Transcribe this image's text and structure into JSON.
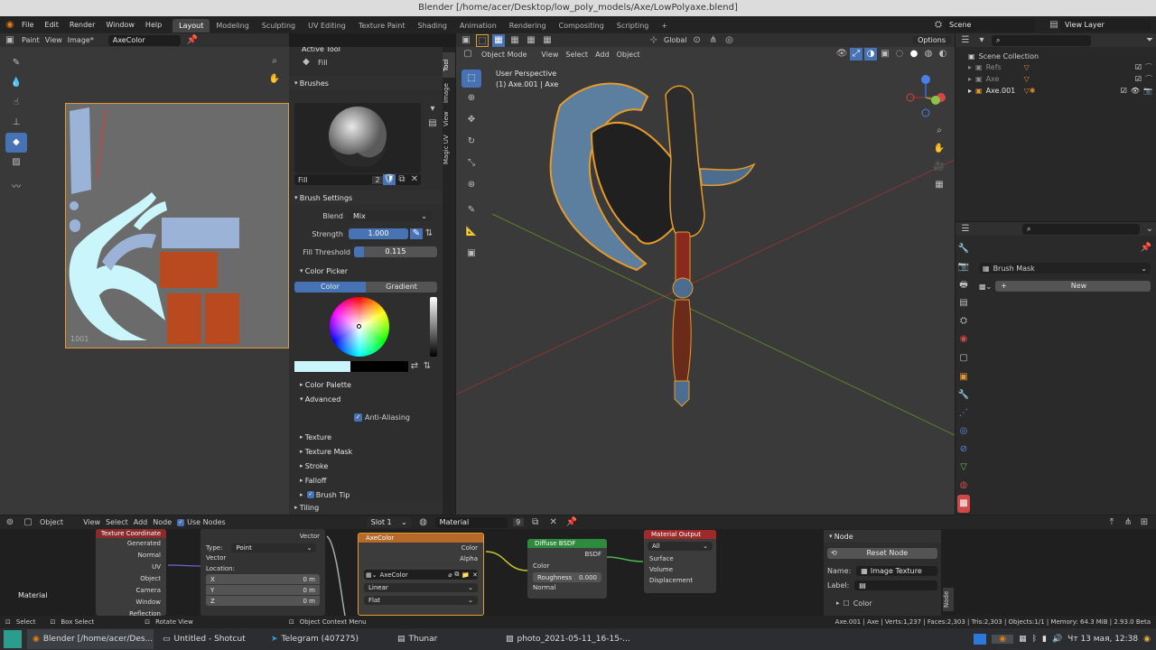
{
  "window_title": "Blender [/home/acer/Desktop/low_poly_models/Axe/LowPolyaxe.blend]",
  "menu": {
    "file": "File",
    "edit": "Edit",
    "render": "Render",
    "window": "Window",
    "help": "Help"
  },
  "workspaces": [
    "Layout",
    "Modeling",
    "Sculpting",
    "UV Editing",
    "Texture Paint",
    "Shading",
    "Animation",
    "Rendering",
    "Compositing",
    "Scripting"
  ],
  "scene": "Scene",
  "view_layer": "View Layer",
  "image_editor": {
    "mode": "Paint",
    "view": "View",
    "image_menu": "Image*",
    "image_name": "AxeColor",
    "tile_label": "1001"
  },
  "tool_panel": {
    "active_tool_header": "Active Tool",
    "active_tool": "Fill",
    "brushes_header": "Brushes",
    "brush_name": "Fill",
    "brush_users": "2",
    "brush_settings_header": "Brush Settings",
    "blend_label": "Blend",
    "blend_value": "Mix",
    "strength_label": "Strength",
    "strength_value": "1.000",
    "strength_fraction": 1.0,
    "fill_threshold_label": "Fill Threshold",
    "fill_threshold_value": "0.115",
    "fill_threshold_fraction": 0.115,
    "color_picker_header": "Color Picker",
    "color_tab": "Color",
    "gradient_tab": "Gradient",
    "current_color": "#c9f5fb",
    "secondary_color": "#000000",
    "color_palette": "Color Palette",
    "advanced": "Advanced",
    "anti_aliasing": "Anti-Aliasing",
    "texture": "Texture",
    "texture_mask": "Texture Mask",
    "stroke": "Stroke",
    "falloff": "Falloff",
    "brush_tip": "Brush Tip",
    "tiling": "Tiling"
  },
  "side_tabs": [
    "Tool",
    "Image",
    "View",
    "Magic UV"
  ],
  "viewport": {
    "mode": "Object Mode",
    "view": "View",
    "select": "Select",
    "add": "Add",
    "object": "Object",
    "transform_orientation": "Global",
    "options": "Options",
    "perspective": "User Perspective",
    "selected": "(1) Axe.001 | Axe"
  },
  "outliner": {
    "scene_collection": "Scene Collection",
    "items": [
      "Refs",
      "Axe",
      "Axe.001"
    ]
  },
  "properties": {
    "brush_mask": "Brush Mask",
    "new_button": "New"
  },
  "node_editor": {
    "type": "Object",
    "view": "View",
    "select": "Select",
    "add": "Add",
    "node": "Node",
    "use_nodes": "Use Nodes",
    "slot": "Slot 1",
    "material": "Material",
    "users": "9",
    "material_label": "Material",
    "tex_coord": {
      "title": "Texture Coordinate",
      "outputs": [
        "Generated",
        "Normal",
        "UV",
        "Object",
        "Camera",
        "Window",
        "Reflection"
      ]
    },
    "mapping": {
      "type_label": "Type:",
      "type_value": "Point",
      "vector": "Vector",
      "location": "Location:",
      "x": "X",
      "y": "Y",
      "z": "Z",
      "zero": "0 m",
      "out": "Vector"
    },
    "axecolor": {
      "title": "AxeColor",
      "color": "Color",
      "alpha": "Alpha",
      "image": "AxeColor",
      "interp": "Linear",
      "proj": "Flat"
    },
    "bsdf": {
      "title": "Diffuse BSDF",
      "out": "BSDF",
      "color": "Color",
      "roughness": "Roughness",
      "roughness_value": "0.000",
      "normal": "Normal"
    },
    "output": {
      "title": "Material Output",
      "target": "All",
      "surface": "Surface",
      "volume": "Volume",
      "displacement": "Displacement"
    },
    "side": {
      "header": "Node",
      "reset": "Reset Node",
      "name_label": "Name:",
      "name_value": "Image Texture",
      "label_label": "Label:",
      "color": "Color",
      "tab": "Node"
    }
  },
  "status": {
    "select": "Select",
    "box_select": "Box Select",
    "rotate_view": "Rotate View",
    "context_menu": "Object Context Menu",
    "stats": "Axe.001 | Axe | Verts:1,237 | Faces:2,303 | Tris:2,303 | Objects:1/1 | Memory: 64.3 MiB | 2.93.0 Beta"
  },
  "taskbar": {
    "blender": "Blender [/home/acer/Des...",
    "shotcut": "Untitled - Shotcut",
    "telegram": "Telegram (407275)",
    "thunar": "Thunar",
    "photo": "photo_2021-05-11_16-15-...",
    "clock": "Чт 13 мая, 12:38"
  }
}
